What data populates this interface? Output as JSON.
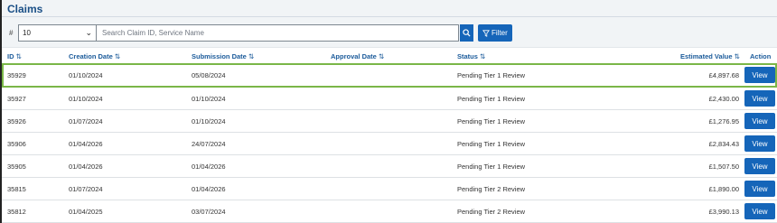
{
  "page": {
    "title": "Claims"
  },
  "toolbar": {
    "page_size_label": "#",
    "page_size_value": "10",
    "search_placeholder": "Search Claim ID, Service Name",
    "filter_label": "Filter"
  },
  "table": {
    "columns": [
      {
        "label": "ID"
      },
      {
        "label": "Creation Date"
      },
      {
        "label": "Submission Date"
      },
      {
        "label": "Approval Date"
      },
      {
        "label": "Status"
      },
      {
        "label": "Estimated Value"
      },
      {
        "label": "Action"
      }
    ],
    "rows": [
      {
        "id": "35929",
        "creation": "01/10/2024",
        "submission": "05/08/2024",
        "approval": "",
        "status": "Pending Tier 1 Review",
        "value": "£4,897.68",
        "action": "View"
      },
      {
        "id": "35927",
        "creation": "01/10/2024",
        "submission": "01/10/2024",
        "approval": "",
        "status": "Pending Tier 1 Review",
        "value": "£2,430.00",
        "action": "View"
      },
      {
        "id": "35926",
        "creation": "01/07/2024",
        "submission": "01/10/2024",
        "approval": "",
        "status": "Pending Tier 1 Review",
        "value": "£1,276.95",
        "action": "View"
      },
      {
        "id": "35906",
        "creation": "01/04/2026",
        "submission": "24/07/2024",
        "approval": "",
        "status": "Pending Tier 1 Review",
        "value": "£2,834.43",
        "action": "View"
      },
      {
        "id": "35905",
        "creation": "01/04/2026",
        "submission": "01/04/2026",
        "approval": "",
        "status": "Pending Tier 1 Review",
        "value": "£1,507.50",
        "action": "View"
      },
      {
        "id": "35815",
        "creation": "01/07/2024",
        "submission": "01/04/2026",
        "approval": "",
        "status": "Pending Tier 2 Review",
        "value": "£1,890.00",
        "action": "View"
      },
      {
        "id": "35812",
        "creation": "01/04/2025",
        "submission": "03/07/2024",
        "approval": "",
        "status": "Pending Tier 2 Review",
        "value": "£3,990.13",
        "action": "View"
      }
    ]
  },
  "colors": {
    "accent": "#1565b9",
    "selected_border": "#7ab648",
    "title": "#1a4f86"
  }
}
